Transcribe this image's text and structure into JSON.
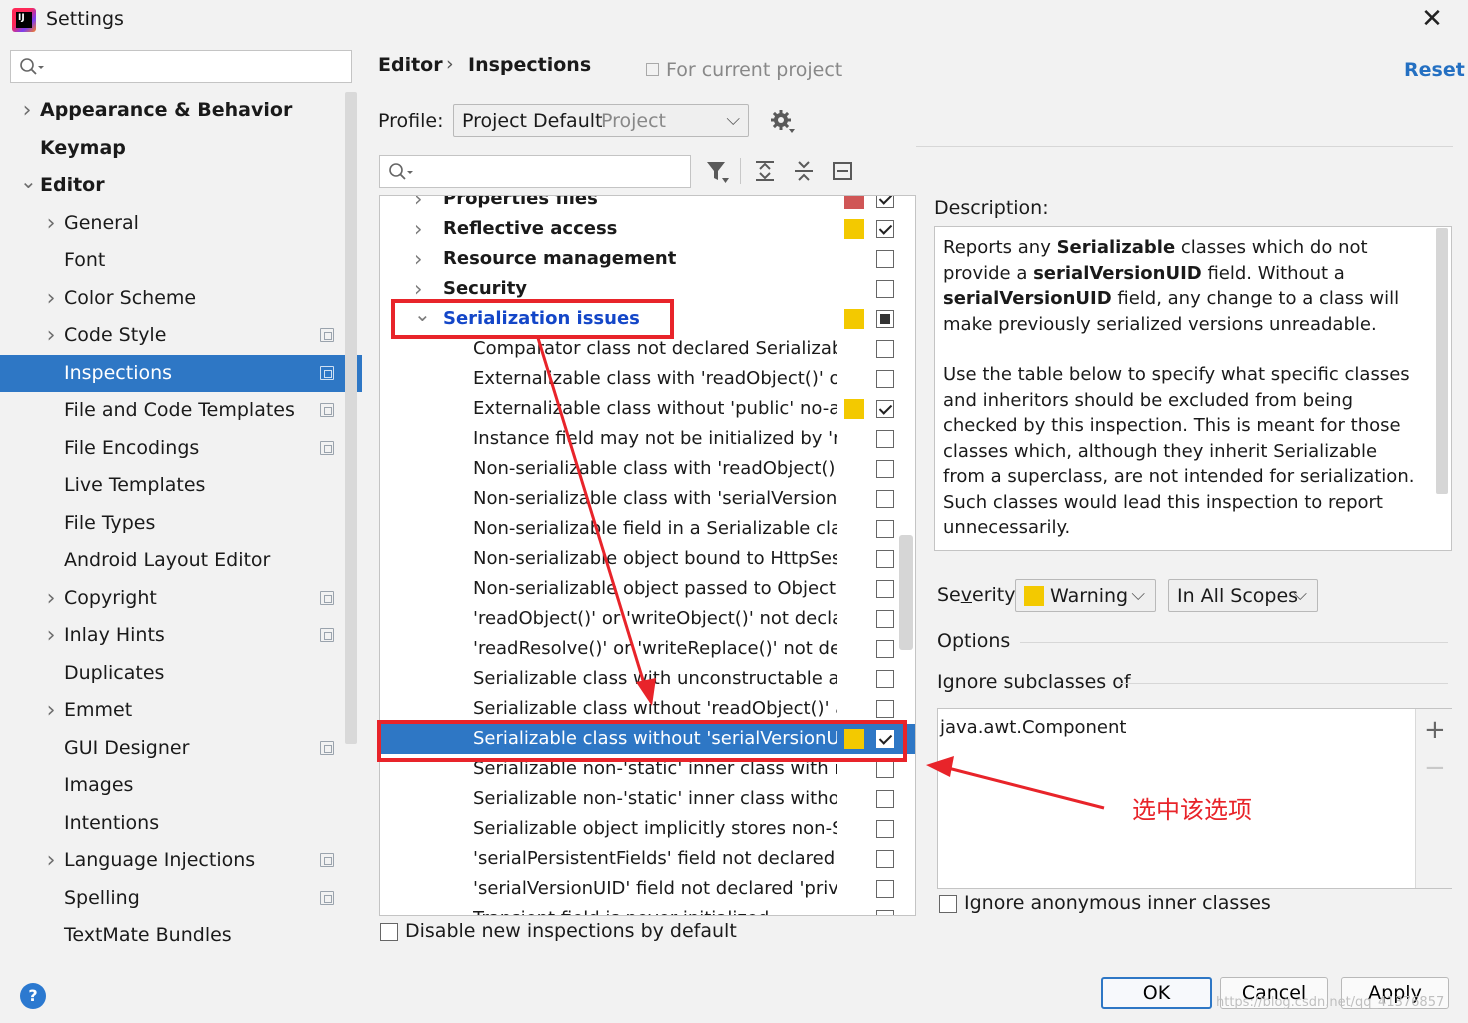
{
  "window": {
    "title": "Settings",
    "close_glyph": "✕"
  },
  "colors": {
    "accent": "#2e77c5",
    "warning": "#f3c900",
    "error": "#d05656",
    "annotation": "#e8242a",
    "link": "#2470c2"
  },
  "sidebar": {
    "items": [
      {
        "label": "Appearance & Behavior",
        "level": 0,
        "bold": true,
        "arrow": "right"
      },
      {
        "label": "Keymap",
        "level": 0,
        "bold": true,
        "arrow": ""
      },
      {
        "label": "Editor",
        "level": 0,
        "bold": true,
        "arrow": "down"
      },
      {
        "label": "General",
        "level": 1,
        "arrow": "right"
      },
      {
        "label": "Font",
        "level": 1,
        "arrow": ""
      },
      {
        "label": "Color Scheme",
        "level": 1,
        "arrow": "right"
      },
      {
        "label": "Code Style",
        "level": 1,
        "arrow": "right",
        "project_icon": true
      },
      {
        "label": "Inspections",
        "level": 1,
        "arrow": "",
        "project_icon": true,
        "selected": true
      },
      {
        "label": "File and Code Templates",
        "level": 1,
        "arrow": "",
        "project_icon": true
      },
      {
        "label": "File Encodings",
        "level": 1,
        "arrow": "",
        "project_icon": true
      },
      {
        "label": "Live Templates",
        "level": 1,
        "arrow": ""
      },
      {
        "label": "File Types",
        "level": 1,
        "arrow": ""
      },
      {
        "label": "Android Layout Editor",
        "level": 1,
        "arrow": ""
      },
      {
        "label": "Copyright",
        "level": 1,
        "arrow": "right",
        "project_icon": true
      },
      {
        "label": "Inlay Hints",
        "level": 1,
        "arrow": "right",
        "project_icon": true
      },
      {
        "label": "Duplicates",
        "level": 1,
        "arrow": ""
      },
      {
        "label": "Emmet",
        "level": 1,
        "arrow": "right"
      },
      {
        "label": "GUI Designer",
        "level": 1,
        "arrow": "",
        "project_icon": true
      },
      {
        "label": "Images",
        "level": 1,
        "arrow": ""
      },
      {
        "label": "Intentions",
        "level": 1,
        "arrow": ""
      },
      {
        "label": "Language Injections",
        "level": 1,
        "arrow": "right",
        "project_icon": true
      },
      {
        "label": "Spelling",
        "level": 1,
        "arrow": "",
        "project_icon": true
      },
      {
        "label": "TextMate Bundles",
        "level": 1,
        "arrow": ""
      }
    ]
  },
  "header": {
    "breadcrumb_editor": "Editor",
    "breadcrumb_sep": "›",
    "breadcrumb_inspections": "Inspections",
    "scope_text": "For current project",
    "reset_label": "Reset"
  },
  "profile": {
    "label": "Profile:",
    "value": "Project Default",
    "suffix": "Project"
  },
  "inspections": {
    "rows": [
      {
        "label": "Properties files",
        "type": "group",
        "severity": "error",
        "check": "checked"
      },
      {
        "label": "Reflective access",
        "type": "group",
        "severity": "warning",
        "check": "checked"
      },
      {
        "label": "Resource management",
        "type": "group",
        "severity": "",
        "check": "none"
      },
      {
        "label": "Security",
        "type": "group",
        "severity": "",
        "check": "none"
      },
      {
        "label": "Serialization issues",
        "type": "group",
        "open": true,
        "severity": "warning",
        "check": "partial"
      },
      {
        "label": "Comparator class not declared Serializable",
        "type": "child",
        "severity": "",
        "check": "none"
      },
      {
        "label": "Externalizable class with 'readObject()' or 'writeObject()'",
        "type": "child",
        "severity": "",
        "check": "none"
      },
      {
        "label": "Externalizable class without 'public' no-arg constructor",
        "type": "child",
        "severity": "warning",
        "check": "checked"
      },
      {
        "label": "Instance field may not be initialized by 'readObject()'",
        "type": "child",
        "severity": "",
        "check": "none"
      },
      {
        "label": "Non-serializable class with 'readObject()' or 'writeObject()'",
        "type": "child",
        "severity": "",
        "check": "none"
      },
      {
        "label": "Non-serializable class with 'serialVersionUID'",
        "type": "child",
        "severity": "",
        "check": "none"
      },
      {
        "label": "Non-serializable field in a Serializable class",
        "type": "child",
        "severity": "",
        "check": "none"
      },
      {
        "label": "Non-serializable object bound to HttpSession",
        "type": "child",
        "severity": "",
        "check": "none"
      },
      {
        "label": "Non-serializable object passed to ObjectOutputStream",
        "type": "child",
        "severity": "",
        "check": "none"
      },
      {
        "label": "'readObject()' or 'writeObject()' not declared 'private'",
        "type": "child",
        "severity": "",
        "check": "none"
      },
      {
        "label": "'readResolve()' or 'writeReplace()' not declared 'protected'",
        "type": "child",
        "severity": "",
        "check": "none"
      },
      {
        "label": "Serializable class with unconstructable ancestor",
        "type": "child",
        "severity": "",
        "check": "none"
      },
      {
        "label": "Serializable class without 'readObject()' and 'writeObject()'",
        "type": "child",
        "severity": "",
        "check": "none"
      },
      {
        "label": "Serializable class without 'serialVersionUID'",
        "type": "child",
        "severity": "warning",
        "check": "checked",
        "selected": true
      },
      {
        "label": "Serializable non-'static' inner class with non-Serializable outer class",
        "type": "child",
        "severity": "",
        "check": "none"
      },
      {
        "label": "Serializable non-'static' inner class without 'serialVersionUID'",
        "type": "child",
        "severity": "",
        "check": "none"
      },
      {
        "label": "Serializable object implicitly stores non-Serializable object",
        "type": "child",
        "severity": "",
        "check": "none"
      },
      {
        "label": "'serialPersistentFields' field not declared 'private static final'",
        "type": "child",
        "severity": "",
        "check": "none"
      },
      {
        "label": "'serialVersionUID' field not declared 'private static final long'",
        "type": "child",
        "severity": "",
        "check": "none"
      },
      {
        "label": "Transient field is never initialized",
        "type": "child",
        "severity": "",
        "check": "none"
      }
    ],
    "disable_new_label": "Disable new inspections by default"
  },
  "description": {
    "label": "Description:",
    "para1": [
      {
        "t": "Reports any "
      },
      {
        "t": "Serializable",
        "b": true
      },
      {
        "t": " classes which do not provide a "
      },
      {
        "t": "serialVersionUID",
        "b": true
      },
      {
        "t": " field. Without a "
      },
      {
        "t": "serialVersionUID",
        "b": true
      },
      {
        "t": " field, any change to a class will make previously serialized versions unreadable."
      }
    ],
    "para2": "Use the table below to specify what specific classes and inheritors should be excluded from being checked by this inspection. This is meant for those classes which, although they inherit Serializable from a superclass, are not intended for serialization. Such classes would lead this inspection to report unnecessarily."
  },
  "severity": {
    "label_pre": "Se",
    "label_u": "v",
    "label_post": "erity:",
    "value": "Warning",
    "scope": "In All Scopes"
  },
  "options": {
    "label": "Options",
    "ignore_label": "Ignore subclasses of",
    "ignore_items": [
      "java.awt.Component"
    ],
    "add_glyph": "+",
    "remove_glyph": "−",
    "anon_label": "Ignore anonymous inner classes"
  },
  "buttons": {
    "ok": "OK",
    "cancel": "Cancel",
    "apply": "Apply",
    "help": "?"
  },
  "annotation": {
    "text": "选中该选项"
  },
  "watermark": "https://blog.csdn.net/qq_41376857"
}
